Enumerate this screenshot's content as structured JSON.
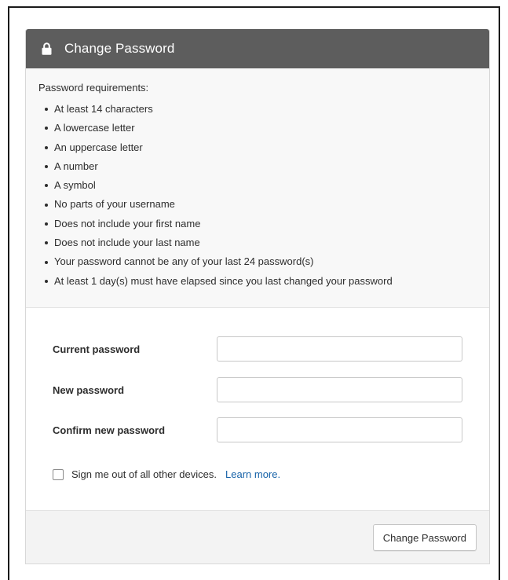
{
  "header": {
    "title": "Change Password",
    "icon": "lock-icon"
  },
  "requirements": {
    "intro": "Password requirements:",
    "items": [
      "At least 14 characters",
      "A lowercase letter",
      "An uppercase letter",
      "A number",
      "A symbol",
      "No parts of your username",
      "Does not include your first name",
      "Does not include your last name",
      "Your password cannot be any of your last 24 password(s)",
      "At least 1 day(s) must have elapsed since you last changed your password"
    ]
  },
  "form": {
    "current_password_label": "Current password",
    "current_password_value": "",
    "new_password_label": "New password",
    "new_password_value": "",
    "confirm_password_label": "Confirm new password",
    "confirm_password_value": ""
  },
  "sign_out": {
    "checked": false,
    "label": "Sign me out of all other devices.",
    "link": "Learn more."
  },
  "footer": {
    "submit_label": "Change Password"
  },
  "colors": {
    "header_bg": "#5d5d5d",
    "link": "#1662a8",
    "requirements_bg": "#f8f8f8",
    "footer_bg": "#f3f3f3"
  }
}
